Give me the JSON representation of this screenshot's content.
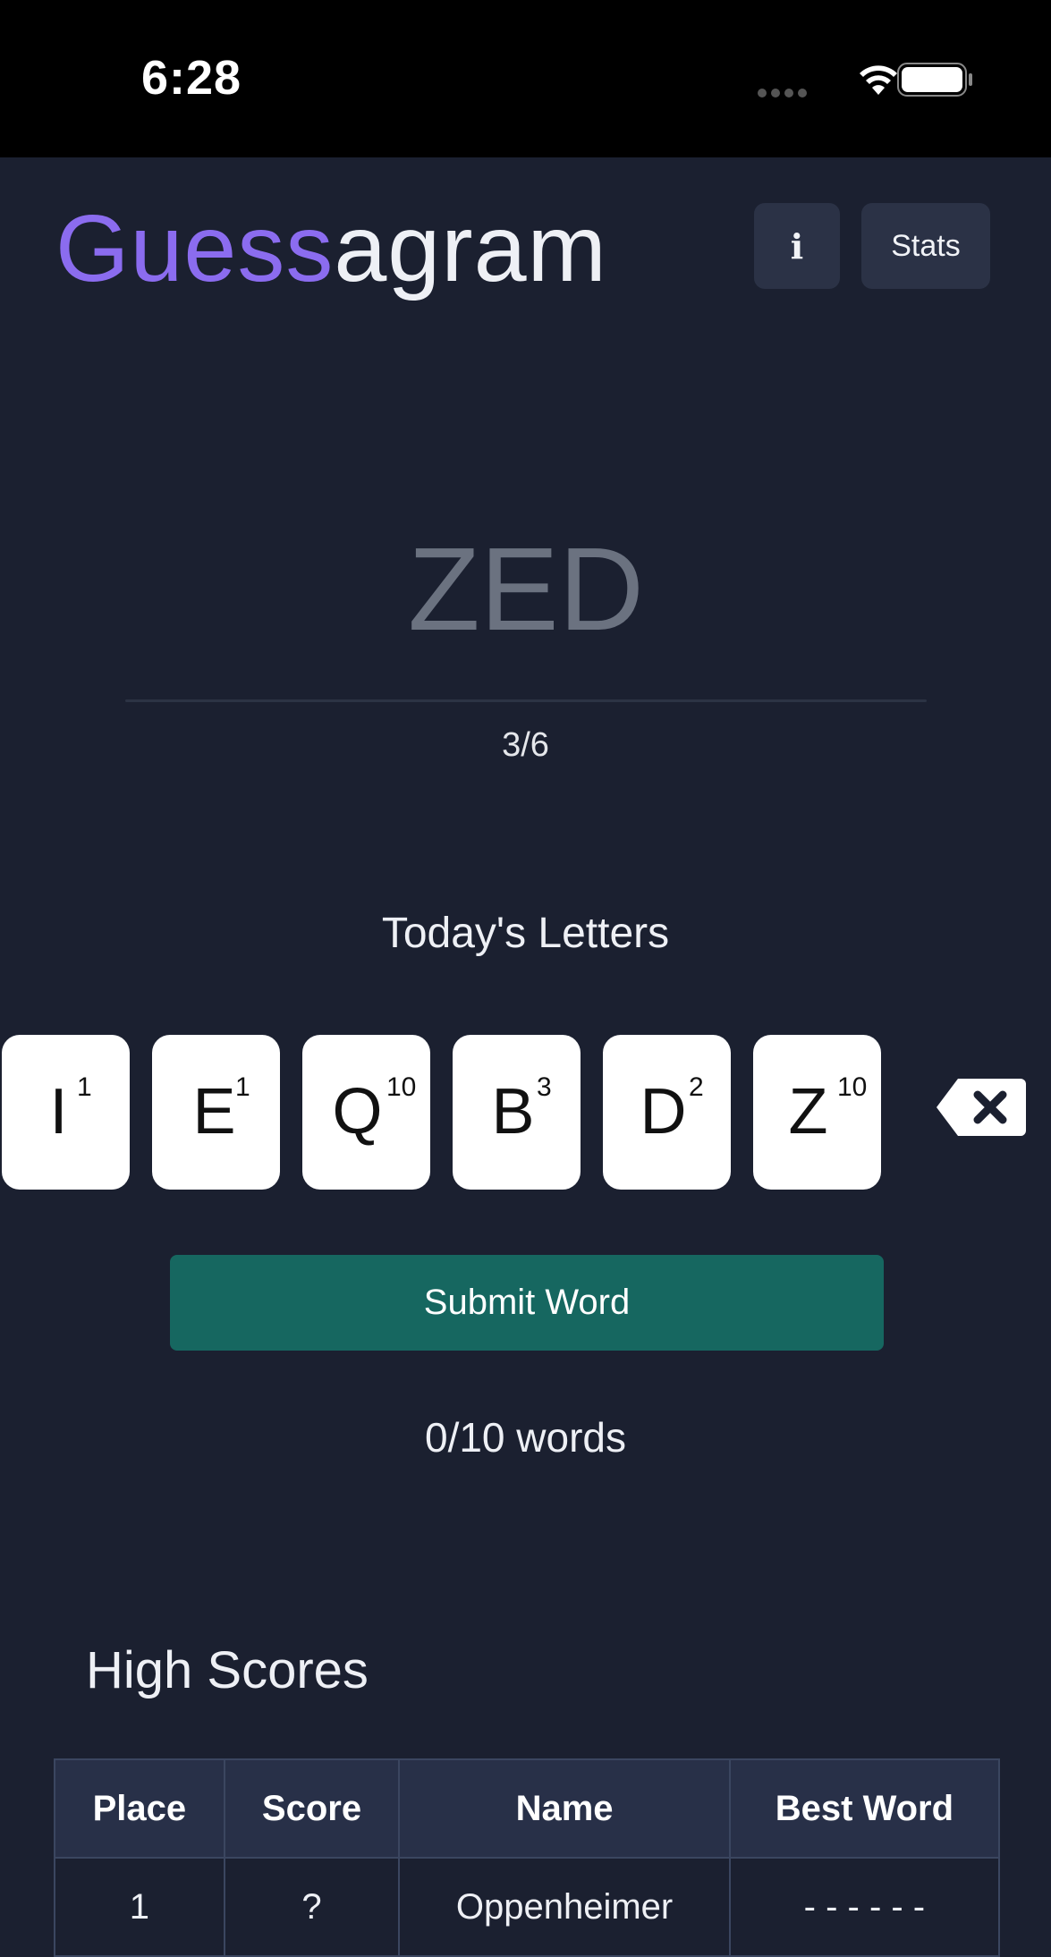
{
  "status_bar": {
    "time": "6:28",
    "icons": [
      "signal-icon",
      "wifi-icon",
      "battery-icon"
    ]
  },
  "header": {
    "logo_part1": "Guess",
    "logo_part2": "agram",
    "info_label": "i",
    "stats_label": "Stats",
    "accent_color": "#8b6cef"
  },
  "game": {
    "current_guess": "ZED",
    "length_indicator": "3/6",
    "letters_title": "Today's Letters",
    "tiles": [
      {
        "letter": "I",
        "points": "1"
      },
      {
        "letter": "E",
        "points": "1"
      },
      {
        "letter": "Q",
        "points": "10"
      },
      {
        "letter": "B",
        "points": "3"
      },
      {
        "letter": "D",
        "points": "2"
      },
      {
        "letter": "Z",
        "points": "10"
      }
    ],
    "submit_label": "Submit Word",
    "submit_color": "#166760",
    "words_count": "0/10 words"
  },
  "high_scores": {
    "title": "High Scores",
    "columns": [
      "Place",
      "Score",
      "Name",
      "Best Word"
    ],
    "rows": [
      [
        "1",
        "?",
        "Oppenheimer",
        "- - - - - -"
      ]
    ]
  }
}
